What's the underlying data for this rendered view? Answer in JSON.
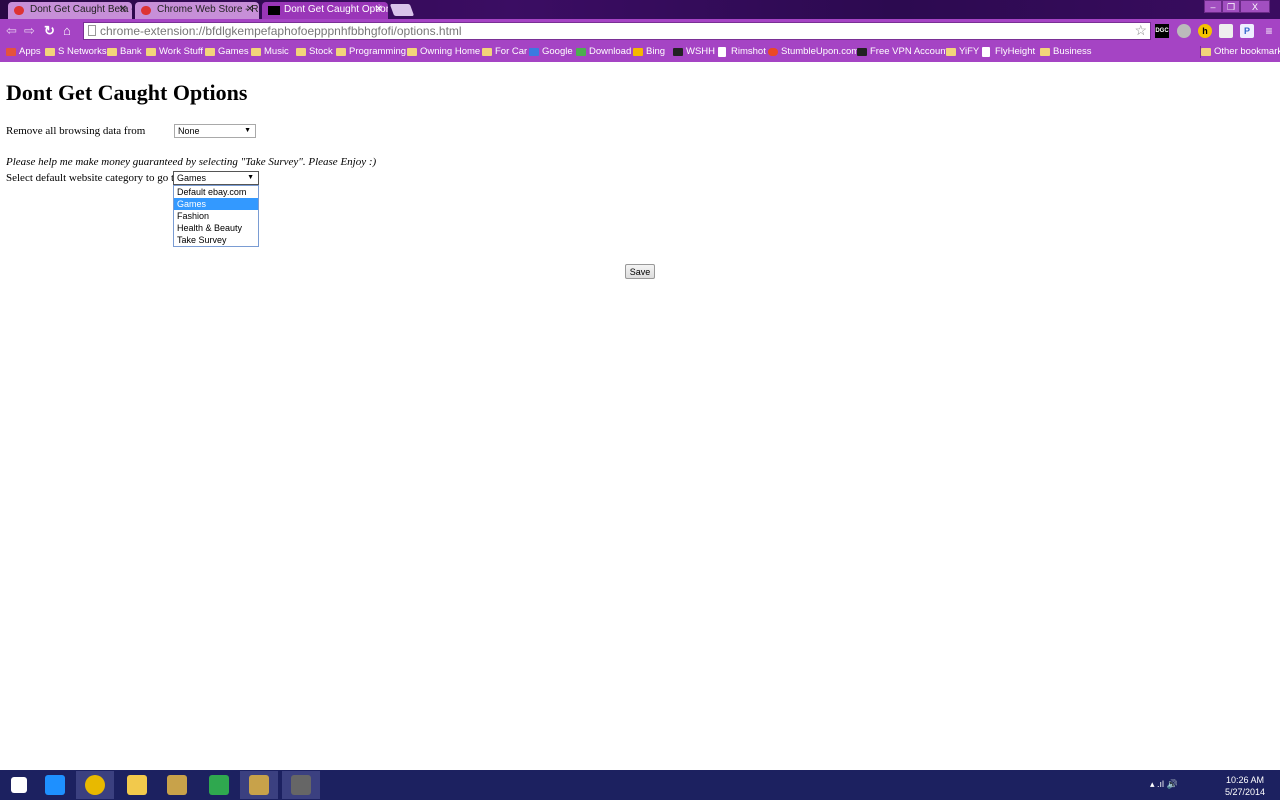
{
  "browser": {
    "tabs": [
      {
        "label": "Dont Get Caught Beta - Ec",
        "active": false
      },
      {
        "label": "Chrome Web Store - Read",
        "active": false
      },
      {
        "label": "Dont Get Caught Options",
        "active": true
      }
    ],
    "url": "chrome-extension://bfdlgkempefaphofoepppnhfbbhgfofi/options.html",
    "window_controls": {
      "minimize": "–",
      "restore": "❐",
      "close": "X"
    },
    "extensions": [
      "DGC",
      "shield",
      "h",
      "printer",
      "P",
      "menu"
    ],
    "bookmarks": [
      "Apps",
      "S Networks",
      "Bank",
      "Work Stuff",
      "Games",
      "Music",
      "Stock",
      "Programming",
      "Owning Home",
      "For Car",
      "Google",
      "Download",
      "Bing",
      "WSHH",
      "Rimshot",
      "StumbleUpon.com",
      "Free VPN Accounts",
      "YiFY",
      "FlyHeight",
      "Business"
    ],
    "other_bookmarks": "Other bookmarks",
    "theme_color": "#a544c4"
  },
  "page": {
    "title": "Dont Get Caught Options",
    "remove_label": "Remove all browsing data from",
    "remove_value": "None",
    "plea": "Please help me make money guaranteed by selecting \"Take Survey\". Please Enjoy :)",
    "category_label": "Select default website category to go to",
    "category_value": "Games",
    "category_options": [
      "Default ebay.com",
      "Games",
      "Fashion",
      "Health & Beauty",
      "Take Survey"
    ],
    "highlighted_option": "Games",
    "save_label": "Save"
  },
  "taskbar": {
    "apps": [
      "start",
      "internet-explorer",
      "chrome",
      "file-explorer",
      "league-of-legends",
      "store",
      "league-of-legends",
      "game"
    ],
    "time": "10:26 AM",
    "date": "5/27/2014"
  }
}
